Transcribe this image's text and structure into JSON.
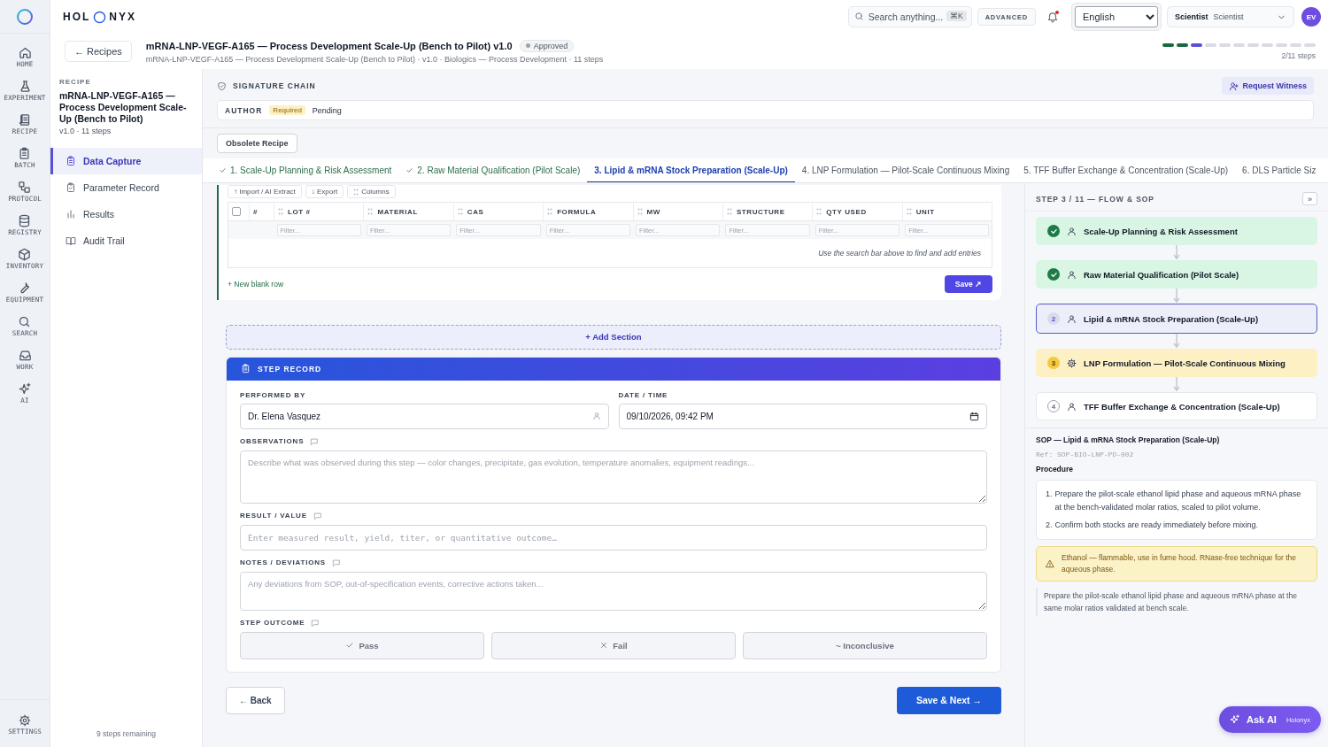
{
  "rail": {
    "items": [
      {
        "label": "HOME"
      },
      {
        "label": "EXPERIMENT"
      },
      {
        "label": "RECIPE"
      },
      {
        "label": "BATCH"
      },
      {
        "label": "PROTOCOL"
      },
      {
        "label": "REGISTRY"
      },
      {
        "label": "INVENTORY"
      },
      {
        "label": "EQUIPMENT"
      },
      {
        "label": "SEARCH"
      },
      {
        "label": "WORK"
      },
      {
        "label": "AI"
      }
    ],
    "settings": "SETTINGS"
  },
  "topbar": {
    "brand_left": "HOL",
    "brand_right": "NYX",
    "search": {
      "placeholder": "Search anything...",
      "shortcut": "⌘K"
    },
    "advanced": "ADVANCED",
    "notifications_unread": true,
    "language": "English",
    "role": {
      "label": "Scientist",
      "value": "Scientist"
    },
    "avatar": "EV"
  },
  "header": {
    "back": "← Recipes",
    "title": "mRNA-LNP-VEGF-A165 — Process Development Scale-Up (Bench to Pilot) v1.0",
    "status": "Approved",
    "subtitle": "mRNA-LNP-VEGF-A165 — Process Development Scale-Up (Bench to Pilot) · v1.0 · Biologics — Process Development · 11 steps",
    "progress": [
      {
        "done": true,
        "current": false
      },
      {
        "done": true,
        "current": false
      },
      {
        "done": false,
        "current": true
      },
      {
        "done": false,
        "current": false
      },
      {
        "done": false,
        "current": false
      },
      {
        "done": false,
        "current": false
      },
      {
        "done": false,
        "current": false
      },
      {
        "done": false,
        "current": false
      },
      {
        "done": false,
        "current": false
      },
      {
        "done": false,
        "current": false
      },
      {
        "done": false,
        "current": false
      }
    ],
    "progress_label": "2/11 steps"
  },
  "recipe_panel": {
    "label": "RECIPE",
    "title": "mRNA-LNP-VEGF-A165 — Process Development Scale-Up (Bench to Pilot)",
    "meta": "v1.0 · 11 steps",
    "nav": [
      {
        "label": "Data Capture",
        "selected": true
      },
      {
        "label": "Parameter Record",
        "selected": false
      },
      {
        "label": "Results",
        "selected": false
      },
      {
        "label": "Audit Trail",
        "selected": false
      }
    ],
    "footer": "9 steps remaining"
  },
  "signature_chain": {
    "title": "SIGNATURE CHAIN",
    "request_button": "Request Witness",
    "signers": [
      {
        "role": "AUTHOR",
        "badge": "Required",
        "status": "Pending"
      }
    ]
  },
  "obsolete_button": "Obsolete Recipe",
  "tabs": [
    {
      "label": "1. Scale-Up Planning & Risk Assessment",
      "done": true,
      "selected": false
    },
    {
      "label": "2. Raw Material Qualification (Pilot Scale)",
      "done": true,
      "selected": false
    },
    {
      "label": "3. Lipid & mRNA Stock Preparation (Scale-Up)",
      "done": false,
      "selected": true
    },
    {
      "label": "4. LNP Formulation — Pilot-Scale Continuous Mixing",
      "done": false,
      "selected": false
    },
    {
      "label": "5. TFF Buffer Exchange & Concentration (Scale-Up)",
      "done": false,
      "selected": false
    },
    {
      "label": "6. DLS Particle Siz",
      "done": false,
      "selected": false
    }
  ],
  "materials_table": {
    "select_all_checked": false,
    "toolbar": [
      "↑ Import / AI Extract",
      "↓ Export",
      "Columns"
    ],
    "columns": [
      "#",
      "LOT #",
      "MATERIAL",
      "CAS",
      "FORMULA",
      "MW",
      "STRUCTURE",
      "QTY USED",
      "UNIT"
    ],
    "filters": [
      "Filter...",
      "Filter...",
      "Filter...",
      "Filter...",
      "Filter...",
      "Filter...",
      "Filter...",
      "Filter..."
    ],
    "empty_message": "Use the search bar above to find and add entries",
    "new_row": "+ New blank row",
    "save": "Save ↗"
  },
  "add_section": "+ Add Section",
  "step_record": {
    "title": "STEP RECORD",
    "performed_by": {
      "label": "PERFORMED BY",
      "value": "Dr. Elena Vasquez"
    },
    "datetime": {
      "label": "DATE / TIME",
      "value": "09/10/2026, 09:42 PM"
    },
    "observations": {
      "label": "OBSERVATIONS",
      "placeholder": "Describe what was observed during this step — color changes, precipitate, gas evolution, temperature anomalies, equipment readings..."
    },
    "result": {
      "label": "RESULT / VALUE",
      "placeholder": "Enter measured result, yield, titer, or quantitative outcome…"
    },
    "notes": {
      "label": "NOTES / DEVIATIONS",
      "placeholder": "Any deviations from SOP, out-of-specification events, corrective actions taken..."
    },
    "outcome": {
      "label": "STEP OUTCOME",
      "options": [
        {
          "label": "Pass",
          "selected": false
        },
        {
          "label": "Fail",
          "selected": false
        },
        {
          "label": "~ Inconclusive",
          "selected": false
        }
      ]
    }
  },
  "nav_buttons": {
    "back": "← Back",
    "next": "Save & Next →"
  },
  "flow_panel": {
    "title": "STEP 3 / 11 — FLOW & SOP",
    "collapse": "»",
    "steps": [
      {
        "done": true,
        "current": false,
        "next": false,
        "kind": "manual",
        "label": "Scale-Up Planning & Risk Assessment"
      },
      {
        "done": true,
        "current": false,
        "next": false,
        "kind": "manual",
        "label": "Raw Material Qualification (Pilot Scale)"
      },
      {
        "done": false,
        "current": true,
        "next": false,
        "kind": "manual",
        "number": "2",
        "label": "Lipid & mRNA Stock Preparation (Scale-Up)"
      },
      {
        "done": false,
        "current": false,
        "next": true,
        "kind": "equipment",
        "number": "3",
        "label": "LNP Formulation — Pilot-Scale Continuous Mixing"
      },
      {
        "done": false,
        "current": false,
        "next": false,
        "kind": "manual",
        "number": "4",
        "label": "TFF Buffer Exchange & Concentration (Scale-Up)"
      }
    ],
    "sop": {
      "title": "SOP — Lipid & mRNA Stock Preparation (Scale-Up)",
      "ref": "Ref: SOP-BIO-LNP-PD-002",
      "procedure_label": "Procedure",
      "procedure": [
        {
          "number": "1.",
          "text": "Prepare the pilot-scale ethanol lipid phase and aqueous mRNA phase at the bench-validated molar ratios, scaled to pilot volume."
        },
        {
          "number": "2.",
          "text": "Confirm both stocks are ready immediately before mixing."
        }
      ],
      "warning": "Ethanol — flammable, use in fume hood. RNase-free technique for the aqueous phase.",
      "note": "Prepare the pilot-scale ethanol lipid phase and aqueous mRNA phase at the same molar ratios validated at bench scale."
    }
  },
  "ask_ai": {
    "label": "Ask AI",
    "brand": "Holonyx"
  }
}
